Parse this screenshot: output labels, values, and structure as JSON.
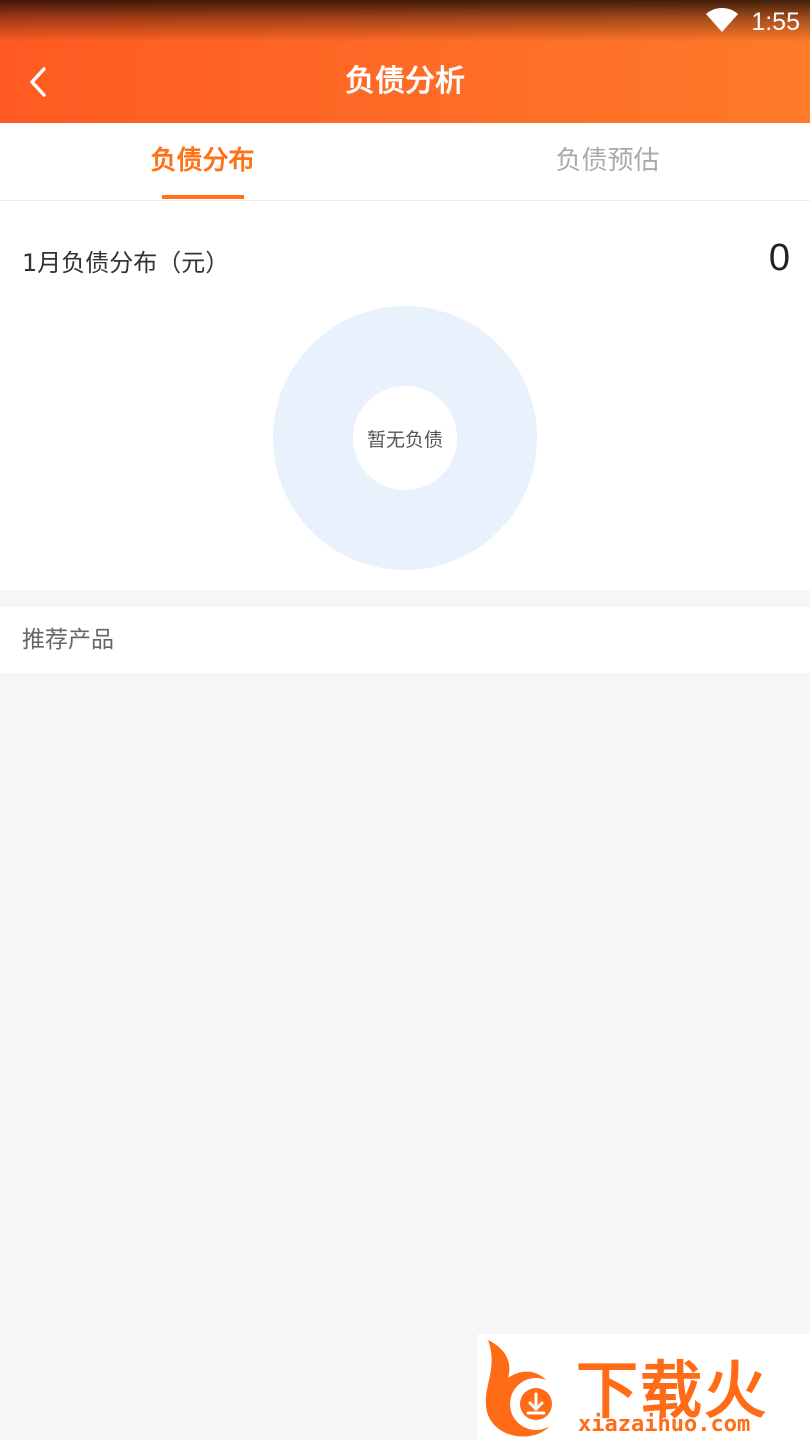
{
  "status_bar": {
    "time": "1:55"
  },
  "header": {
    "title": "负债分析"
  },
  "tabs": [
    {
      "label": "负债分布",
      "active": true
    },
    {
      "label": "负债预估",
      "active": false
    }
  ],
  "distribution": {
    "label": "1月负债分布（元）",
    "total": "0",
    "empty_text": "暂无负债"
  },
  "recommend": {
    "title": "推荐产品"
  },
  "watermark": {
    "brand": "下载火",
    "url": "xiazaihuo.com"
  },
  "colors": {
    "header_start": "#ff5a22",
    "header_end": "#ff7a2a",
    "accent": "#ff7216",
    "donut_fill": "#e9f1fd"
  }
}
